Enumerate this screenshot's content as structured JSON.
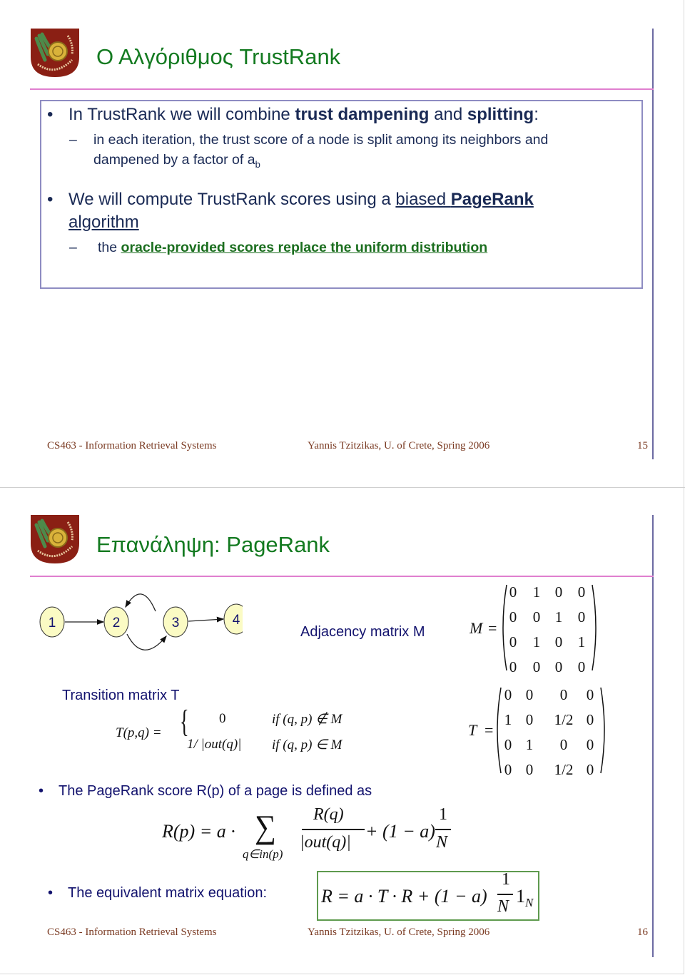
{
  "slide1": {
    "title": "Ο Αλγόριθμος TrustRank",
    "logo": "university-of-crete-logo",
    "bullets": [
      {
        "pre": "In TrustRank we will combine ",
        "bold1": "trust dampening",
        "mid": " and ",
        "bold2": "splitting",
        "post": ":",
        "sub": {
          "line1": "in each iteration, the trust score of a node is split among its neighbors and",
          "line2": "dampened by a factor of a",
          "subscript": "b"
        }
      },
      {
        "pre": "We will compute TrustRank scores using a ",
        "underlined": "biased ",
        "bold_underlined": "PageRank",
        "line2": "algorithm",
        "sub": {
          "pre": "the ",
          "green": "oracle-provided scores replace the uniform distribution"
        }
      }
    ],
    "footer": {
      "course": "CS463 -  Information Retrieval Systems",
      "author": "Yannis Tzitzikas, U. of Crete, Spring  2006",
      "page": "15"
    }
  },
  "slide2": {
    "title": "Επανάληψη: PageRank",
    "logo": "university-of-crete-logo",
    "graph": {
      "nodes": [
        "1",
        "2",
        "3",
        "4"
      ],
      "edges": [
        [
          "1",
          "2"
        ],
        [
          "2",
          "3"
        ],
        [
          "3",
          "2"
        ],
        [
          "3",
          "4"
        ]
      ],
      "node_fill": "#fbfbc4",
      "label_color": "#13136e"
    },
    "adjacency": {
      "label": "Adjacency  matrix M",
      "symbol": "M",
      "equals": "=",
      "rows": [
        [
          "0",
          "1",
          "0",
          "0"
        ],
        [
          "0",
          "0",
          "1",
          "0"
        ],
        [
          "0",
          "1",
          "0",
          "1"
        ],
        [
          "0",
          "0",
          "0",
          "0"
        ]
      ]
    },
    "transition": {
      "label": "Transition matrix T",
      "def_lhs": "T(p,q) =",
      "case1_value": "0",
      "case1_cond": "if (q, p) ∉ M",
      "case2_value": "1/ |out(q)|",
      "case2_cond": "if (q, p) ∈ M",
      "symbol": "T",
      "equals": "=",
      "rows": [
        [
          "0",
          "0",
          "0",
          "0"
        ],
        [
          "1",
          "0",
          "1/2",
          "0"
        ],
        [
          "0",
          "1",
          "0",
          "0"
        ],
        [
          "0",
          "0",
          "1/2",
          "0"
        ]
      ]
    },
    "pagerank_def": {
      "bullet": "The PageRank score R(p) of a page is defined as",
      "lhs": "R(p) = a ·",
      "sum": "∑",
      "sum_index": "q∈in(p)",
      "frac_num": "R(q)",
      "frac_den": "|out(q)|",
      "plus": "+ (1 − a)",
      "one": "1",
      "N": "N"
    },
    "matrix_eq": {
      "bullet": "The equivalent matrix equation:",
      "lhs": "R = a · T · R + (1 − a)",
      "one": "1",
      "N": "N",
      "vec": "1",
      "vec_sub": "N"
    },
    "footer": {
      "course": "CS463 -  Information Retrieval Systems",
      "author": "Yannis Tzitzikas, U. of Crete, Spring  2006",
      "page": "16"
    }
  }
}
